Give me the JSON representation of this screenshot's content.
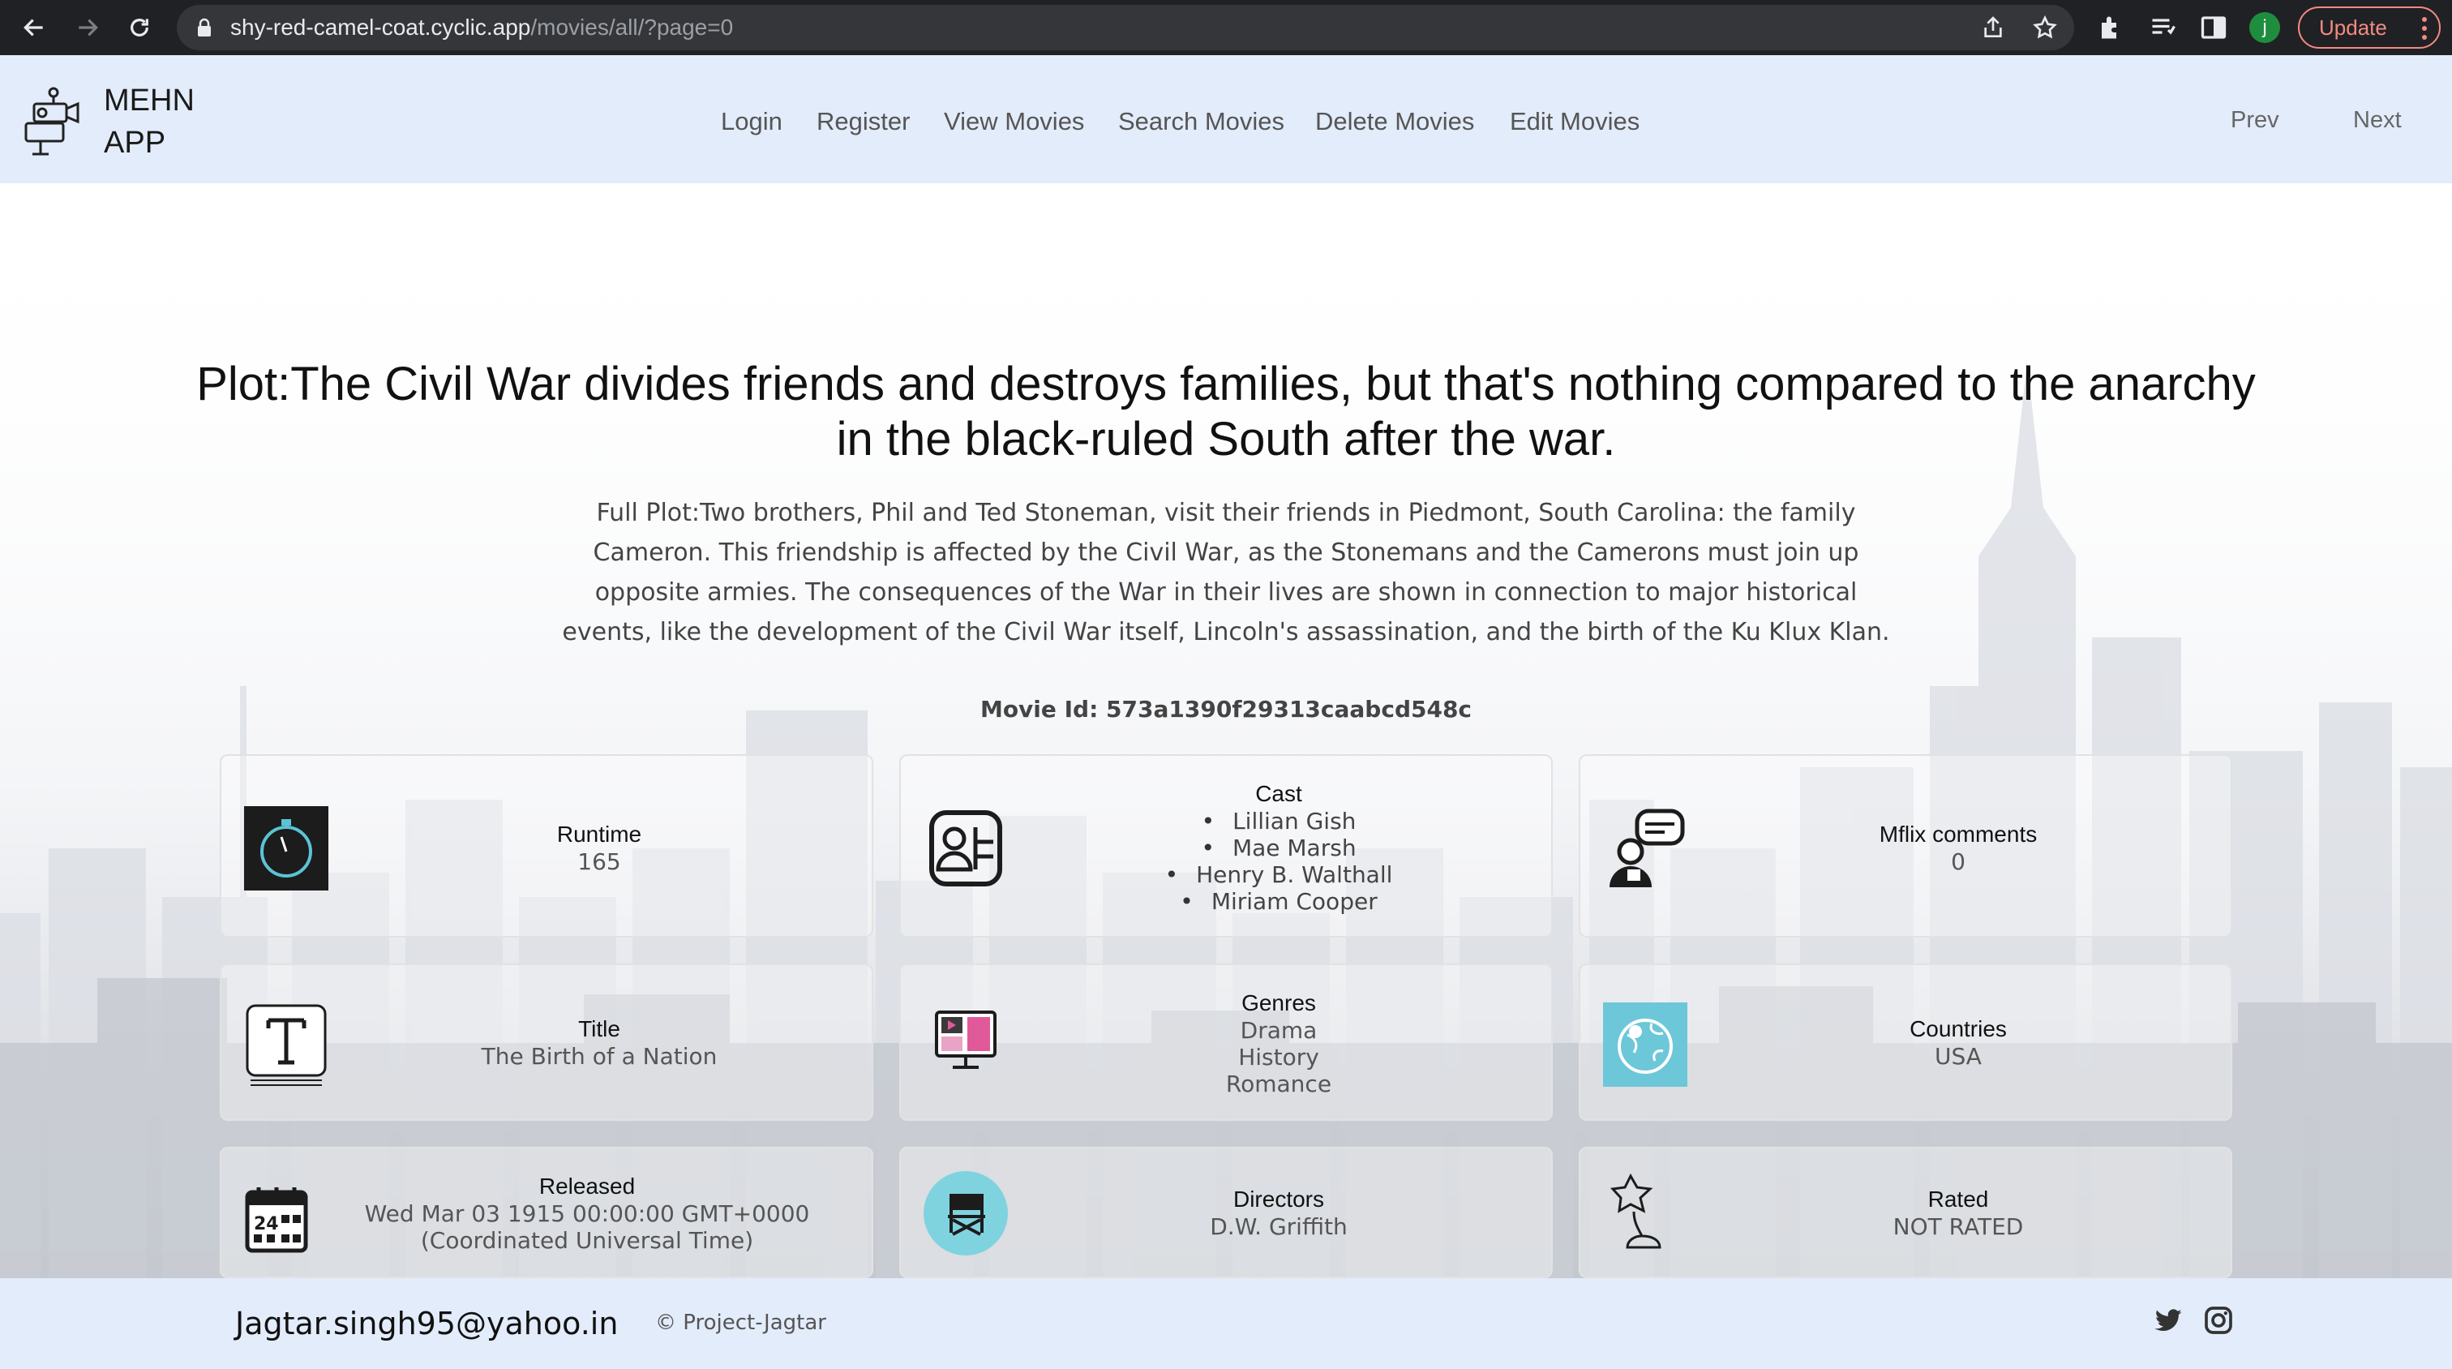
{
  "browser": {
    "url_host": "shy-red-camel-coat.cyclic.app",
    "url_path": "/movies/all/?page=0",
    "profile_initial": "j",
    "update_label": "Update"
  },
  "header": {
    "brand": "MEHN APP",
    "nav": [
      "Login",
      "Register",
      "View Movies",
      "Search Movies",
      "Delete Movies",
      "Edit Movies"
    ],
    "prev": "Prev",
    "next": "Next"
  },
  "movie": {
    "plot": "Plot:The Civil War divides friends and destroys families, but that's nothing compared to the anarchy in the black-ruled South after the war.",
    "full_plot": "Full Plot:Two brothers, Phil and Ted Stoneman, visit their friends in Piedmont, South Carolina: the family Cameron. This friendship is affected by the Civil War, as the Stonemans and the Camerons must join up opposite armies. The consequences of the War in their lives are shown in connection to major historical events, like the development of the Civil War itself, Lincoln's assassination, and the birth of the Ku Klux Klan.",
    "movie_id": "Movie Id: 573a1390f29313caabcd548c",
    "runtime": {
      "label": "Runtime",
      "value": "165"
    },
    "cast": {
      "label": "Cast",
      "items": [
        "Lillian Gish",
        "Mae Marsh",
        "Henry B. Walthall",
        "Miriam Cooper"
      ]
    },
    "comments": {
      "label": "Mflix comments",
      "value": "0"
    },
    "title": {
      "label": "Title",
      "value": "The Birth of a Nation"
    },
    "genres": {
      "label": "Genres",
      "items": [
        "Drama",
        "History",
        "Romance"
      ]
    },
    "countries": {
      "label": "Countries",
      "value": "USA"
    },
    "released": {
      "label": "Released",
      "value": "Wed Mar 03 1915 00:00:00 GMT+0000 (Coordinated Universal Time)"
    },
    "directors": {
      "label": "Directors",
      "value": "D.W. Griffith"
    },
    "rated": {
      "label": "Rated",
      "value": "NOT RATED"
    }
  },
  "footer": {
    "email": "Jagtar.singh95@yahoo.in",
    "copyright": "© Project-Jagtar"
  },
  "icons": [
    "back-arrow-icon",
    "forward-arrow-icon",
    "reload-icon",
    "lock-icon",
    "share-icon",
    "star-icon",
    "puzzle-icon",
    "reading-list-icon",
    "side-panel-icon",
    "camera-logo-icon",
    "stopwatch-icon",
    "cast-card-icon",
    "comments-icon",
    "title-icon",
    "genres-icon",
    "globe-icon",
    "calendar-icon",
    "director-chair-icon",
    "award-icon",
    "twitter-icon",
    "instagram-icon"
  ],
  "colors": {
    "header_bg": "#e3ecfa",
    "chrome_bg": "#202124",
    "update_accent": "#f28b82",
    "globe_tile": "#6cc7d9",
    "chair_circle": "#7fd3df"
  }
}
